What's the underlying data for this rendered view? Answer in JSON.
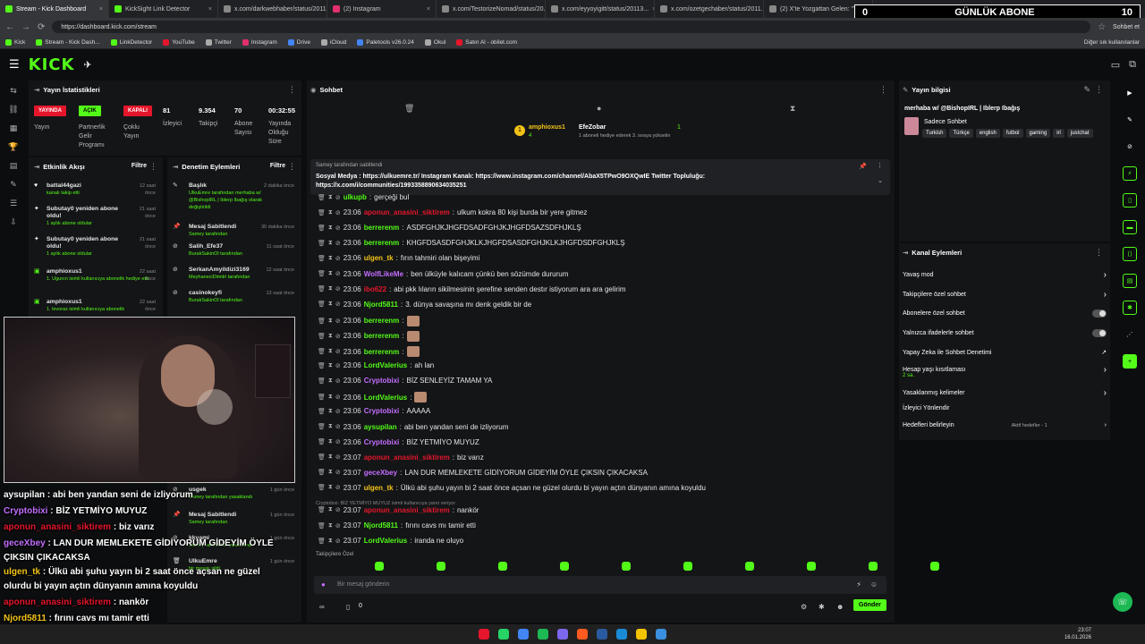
{
  "browser": {
    "tabs": [
      "Stream - Kick Dashboard",
      "KickSight Link Detector",
      "x.com/darkwebhaber/status/2011...",
      "(2) Instagram",
      "x.com/TestorizeNomad/status/20...",
      "x.com/eyyoyigitt/status/20113...",
      "x.com/ozetgechaber/status/2011...",
      "(2) X'te Yozgattan Gelen: \"Yolug k..."
    ],
    "url": "https://dashboard.kick.com/stream",
    "bookmarks": [
      "Kick",
      "Stream - Kick Dash...",
      "LinkDetector",
      "YouTube",
      "Twitter",
      "Instagram",
      "Drive",
      "iCloud",
      "Paletools v26.0.24",
      "Okul",
      "Satın Al - obilet.com"
    ],
    "bookmarks_other": "Diğer sık kullanılanlar",
    "sidebar_chat": "Sohbet et"
  },
  "abone_overlay": {
    "left": "0",
    "title": "GÜNLÜK ABONE",
    "right": "10"
  },
  "stats": {
    "title": "Yayın İstatistikleri",
    "badges": [
      {
        "label": "YAYINDA",
        "color": "#e5162b"
      },
      {
        "label": "AÇIK",
        "color": "#53fc18"
      },
      {
        "label": "KAPALI",
        "color": "#e5162b"
      }
    ],
    "labels": [
      "Yayın",
      "Partnerlik Gelir Programı",
      "Çoklu Yayın"
    ],
    "values": [
      "81",
      "9.354",
      "70",
      "00:32:55"
    ],
    "value_labels": [
      "İzleyici",
      "Takipçi",
      "Abone Sayısı",
      "Yayında Olduğu Süre"
    ]
  },
  "activity": {
    "title": "Etkinlik Akışı",
    "filter": "Filtre",
    "items": [
      {
        "name": "battal44gazi",
        "sub": "kanalı takip etti",
        "time": "12 saat önce"
      },
      {
        "name": "Subutay0 yeniden abone oldu!",
        "sub": "1 aylık abone oldular",
        "time": "21 saat önce"
      },
      {
        "name": "Subutay0 yeniden abone oldu!",
        "sub": "1 aylık abone oldular",
        "time": "21 saat önce"
      },
      {
        "name": "amphioxus1",
        "sub": "1. Ugurcn isimli kullanıcıya abonelik hediye etti.",
        "time": "22 saat önce"
      },
      {
        "name": "amphioxus1",
        "sub": "1. levorax isimli kullanıcıya abonelik",
        "time": "22 saat önce"
      }
    ]
  },
  "mod": {
    "title": "Denetim Eylemleri",
    "filter": "Filtre",
    "items": [
      {
        "name": "Başlık",
        "sub": "UlkuEmre tarafından merhaba w/ @BishopIRL | Iblerp Ibağış olarak değiştirildi",
        "time": "2 dakika önce"
      },
      {
        "name": "Mesaj Sabitlendi",
        "sub": "Samey tarafından",
        "time": "30 dakika önce"
      },
      {
        "name": "Salih_Efe37",
        "sub": "BurakSakinOl tarafından",
        "time": "11 saat önce"
      },
      {
        "name": "SerkanAmyildizi3169",
        "sub": "MeyhaneciDimitri tarafından",
        "time": "12 saat önce"
      },
      {
        "name": "casinokeyfi",
        "sub": "BurakSakinOl tarafından",
        "time": "13 saat önce"
      },
      {
        "name": "usgek",
        "sub": "Samey tarafından yasaklandı",
        "time": "1 gün önce"
      },
      {
        "name": "Mesaj Sabitlendi",
        "sub": "Samey tarafından",
        "time": "1 gün önce"
      },
      {
        "name": "kkyami",
        "sub": "Samey tarafından yasaklandı",
        "time": "1 gün önce"
      },
      {
        "name": "UlkuEmre",
        "sub": "bir mesajı sildi",
        "time": "1 gün önce"
      }
    ]
  },
  "chat": {
    "title": "Sohbet",
    "top_gifter": {
      "name": "amphioxus1",
      "count": "4",
      "rank": "1"
    },
    "gift_info": {
      "name": "EfeZobar",
      "text": "1 aboneli hediye ederek 3. sıraya yükselin",
      "count": "1"
    },
    "pinned": {
      "by": "Samey tarafından sabitlendi",
      "text": "Sosyal Medya : https://ulkuemre.tr/ Instagram Kanalı: https://www.instagram.com/channel/AbaX5TPwO9OXQwIE Twitter Topluluğu: https://x.com/i/communities/1993358890634035251"
    },
    "messages": [
      {
        "time": "",
        "user": "ulkupb",
        "color": "#53fc18",
        "text": "gerçeği bul"
      },
      {
        "time": "23:06",
        "user": "aponun_anasini_siktirem",
        "color": "#e5162b",
        "text": "ulkum kokra 80 kişi burda bir yere gitmez"
      },
      {
        "time": "23:06",
        "user": "berrerenm",
        "color": "#53fc18",
        "text": "ASDFGHJKJHGFDSADFGHJKJHGFDSAZSDFHJKLŞ"
      },
      {
        "time": "23:06",
        "user": "berrerenm",
        "color": "#53fc18",
        "text": "KHGFDSASDFGHJKLKJHGFDSASDFGHJKLKJHGFDSDFGHJKLŞ"
      },
      {
        "time": "23:06",
        "user": "ulgen_tk",
        "color": "#f2c318",
        "text": "fırın tahmiri olan bişeyimi"
      },
      {
        "time": "23:06",
        "user": "WolfLikeMe",
        "color": "#c36eff",
        "text": "ben ülküyle kalıcam çünkü ben sözümde dururum"
      },
      {
        "time": "23:06",
        "user": "ibo622",
        "color": "#e5162b",
        "text": "abi pkk lıların sikilmesinin şerefine senden destır istiyorum ara ara gelirim"
      },
      {
        "time": "23:06",
        "user": "Njord5811",
        "color": "#53fc18",
        "text": "3. dünya savaşına mı denk geldik bir de"
      },
      {
        "time": "23:06",
        "user": "berrerenm",
        "color": "#53fc18",
        "text": ""
      },
      {
        "time": "23:06",
        "user": "berrerenm",
        "color": "#53fc18",
        "text": ""
      },
      {
        "time": "23:06",
        "user": "berrerenm",
        "color": "#53fc18",
        "text": ""
      },
      {
        "time": "23:06",
        "user": "LordValerius",
        "color": "#53fc18",
        "text": "ah lan"
      },
      {
        "time": "23:06",
        "user": "Cryptobixi",
        "color": "#c36eff",
        "text": "BİZ SENLEYİZ TAMAM YA"
      },
      {
        "time": "23:06",
        "user": "LordValerius",
        "color": "#53fc18",
        "text": ""
      },
      {
        "time": "23:06",
        "user": "Cryptobixi",
        "color": "#c36eff",
        "text": "AAAAA"
      },
      {
        "time": "23:06",
        "user": "aysupilan",
        "color": "#53fc18",
        "text": "abi ben yandan seni de izliyorum"
      },
      {
        "time": "23:06",
        "user": "Cryptobixi",
        "color": "#c36eff",
        "text": "BİZ YETMİYO MUYUZ"
      },
      {
        "time": "23:07",
        "user": "aponun_anasini_siktirem",
        "color": "#e5162b",
        "text": "biz varız"
      },
      {
        "time": "23:07",
        "user": "geceXbey",
        "color": "#c36eff",
        "text": "LAN DUR MEMLEKETE GİDİYORUM GİDEYİM ÖYLE ÇIKSIN ÇIKACAKSA"
      },
      {
        "time": "23:07",
        "user": "ulgen_tk",
        "color": "#f2c318",
        "text": "Ülkü abi şuhu yayın bi 2 saat önce açsan ne güzel olurdu bi yayın açtın dünyanın amına koyuldu"
      },
      {
        "time": "23:07",
        "user": "aponun_anasini_siktirem",
        "color": "#e5162b",
        "text": "nankör"
      },
      {
        "time": "23:07",
        "user": "Njord5811",
        "color": "#53fc18",
        "text": "fırını cavs mı tamir etti"
      },
      {
        "time": "23:07",
        "user": "LordValerius",
        "color": "#53fc18",
        "text": "iranda ne oluyo"
      }
    ],
    "reply_note": "Cryptobixi: BİZ YETMİYO MUYUZ isimli kullanıcıya yanıt veriyor",
    "followers_only": "Takipçilere Özel",
    "input_placeholder": "Bir mesaj gönderin",
    "send_label": "Gönder",
    "points": "0"
  },
  "info": {
    "title": "Yayın bilgisi",
    "stream_title": "merhaba w/ @BishopIRL | Iblerp Ibağış",
    "category": "Sadece Sohbet",
    "tags": [
      "Turkish",
      "Türkçe",
      "english",
      "futbol",
      "gaming",
      "irl",
      "justchat"
    ]
  },
  "actions": {
    "title": "Kanal Eylemleri",
    "items": [
      "Yavaş mod",
      "Takipçilere özel sohbet",
      "Abonelere özel sohbet",
      "Yalnızca ifadelerle sohbet",
      "Yapay Zeka ile Sohbet Denetimi",
      "Hesap yaşı kısıtlaması",
      "Yasaklanmış kelimeler",
      "İzleyici Yönlendir",
      "Hedefleri belirleyin"
    ],
    "age_value": "2 sa.",
    "goals_status": "Aktif hedefler - 1"
  },
  "overlay_chat": [
    {
      "user": "aysupilan",
      "color": "#ffffff",
      "text": "abi ben yandan seni de izliyorum"
    },
    {
      "user": "Cryptobixi",
      "color": "#c36eff",
      "text": "BİZ YETMİYO MUYUZ"
    },
    {
      "user": "aponun_anasini_siktirem",
      "color": "#e5162b",
      "text": "biz varız"
    },
    {
      "user": "geceXbey",
      "color": "#c36eff",
      "text": "LAN DUR MEMLEKETE GİDİYORUM GİDEYİM ÖYLE"
    },
    {
      "user": "",
      "color": "#ffffff",
      "text": "ÇIKSIN ÇIKACAKSA"
    },
    {
      "user": "ulgen_tk",
      "color": "#f2c318",
      "text": "Ülkü abi şuhu yayın bi 2 saat önce açsan ne güzel"
    },
    {
      "user": "",
      "color": "#ffffff",
      "text": "olurdu bi yayın açtın dünyanın amına koyuldu"
    },
    {
      "user": "aponun_anasini_siktirem",
      "color": "#e5162b",
      "text": "nankör"
    },
    {
      "user": "Njord5811",
      "color": "#f2c318",
      "text": "fırını cavs mı tamir etti"
    },
    {
      "user": "LordValerius",
      "color": "#53fc18",
      "text": "iranda ne oluyo"
    }
  ],
  "clock": {
    "time": "23:07",
    "date": "16.01.2026"
  },
  "colors": {
    "accent": "#53fc18",
    "danger": "#e5162b"
  }
}
